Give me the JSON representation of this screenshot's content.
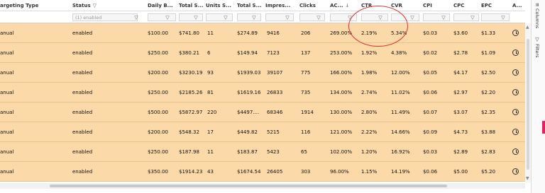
{
  "columns": [
    {
      "key": "targeting_type",
      "label": "argeting Type",
      "filter_icon": false
    },
    {
      "key": "status",
      "label": "Status",
      "filter_icon": true
    },
    {
      "key": "daily_budget",
      "label": "Daily B...",
      "filter_icon": false
    },
    {
      "key": "total_spend",
      "label": "Total S...",
      "filter_icon": false
    },
    {
      "key": "units_sold",
      "label": "Units S...",
      "filter_icon": false
    },
    {
      "key": "total_sales",
      "label": "Total S...",
      "filter_icon": false
    },
    {
      "key": "impressions",
      "label": "Impres...",
      "filter_icon": false
    },
    {
      "key": "clicks",
      "label": "Clicks",
      "filter_icon": false
    },
    {
      "key": "acos",
      "label": "AC...",
      "filter_icon": false,
      "sort_icon": "↓"
    },
    {
      "key": "ctr",
      "label": "CTR",
      "filter_icon": false
    },
    {
      "key": "cvr",
      "label": "CVR",
      "filter_icon": false
    },
    {
      "key": "cpi",
      "label": "CPI",
      "filter_icon": false
    },
    {
      "key": "cpc",
      "label": "CPC",
      "filter_icon": false
    },
    {
      "key": "epc",
      "label": "EPC",
      "filter_icon": false
    },
    {
      "key": "actions",
      "label": "A...",
      "filter_icon": false
    }
  ],
  "filters": {
    "status_value": "(1) enabled",
    "funnel_glyph": "▽"
  },
  "rows": [
    {
      "targeting_type": "anual",
      "status": "enabled",
      "daily_budget": "$100.00",
      "total_spend": "$741.80",
      "units_sold": "11",
      "total_sales": "$274.89",
      "impressions": "9416",
      "clicks": "206",
      "acos": "269.00%",
      "ctr": "2.19%",
      "cvr": "5.34%",
      "cpi": "$0.03",
      "cpc": "$3.60",
      "epc": "$1.33"
    },
    {
      "targeting_type": "anual",
      "status": "enabled",
      "daily_budget": "$250.00",
      "total_spend": "$380.21",
      "units_sold": "6",
      "total_sales": "$149.94",
      "impressions": "7123",
      "clicks": "137",
      "acos": "253.00%",
      "ctr": "1.92%",
      "cvr": "4.38%",
      "cpi": "$0.02",
      "cpc": "$2.78",
      "epc": "$1.09"
    },
    {
      "targeting_type": "anual",
      "status": "enabled",
      "daily_budget": "$200.00",
      "total_spend": "$3230.19",
      "units_sold": "93",
      "total_sales": "$1939.03",
      "impressions": "39107",
      "clicks": "775",
      "acos": "166.00%",
      "ctr": "1.98%",
      "cvr": "12.00%",
      "cpi": "$0.05",
      "cpc": "$4.17",
      "epc": "$2.50"
    },
    {
      "targeting_type": "anual",
      "status": "enabled",
      "daily_budget": "$250.00",
      "total_spend": "$2185.26",
      "units_sold": "81",
      "total_sales": "$1619.16",
      "impressions": "26833",
      "clicks": "735",
      "acos": "134.00%",
      "ctr": "2.74%",
      "cvr": "11.02%",
      "cpi": "$0.06",
      "cpc": "$2.97",
      "epc": "$2.20"
    },
    {
      "targeting_type": "anual",
      "status": "enabled",
      "daily_budget": "$500.00",
      "total_spend": "$5872.97",
      "units_sold": "220",
      "total_sales": "$4497....",
      "impressions": "68346",
      "clicks": "1914",
      "acos": "130.00%",
      "ctr": "2.80%",
      "cvr": "11.49%",
      "cpi": "$0.07",
      "cpc": "$3.07",
      "epc": "$2.35"
    },
    {
      "targeting_type": "anual",
      "status": "enabled",
      "daily_budget": "$200.00",
      "total_spend": "$548.32",
      "units_sold": "17",
      "total_sales": "$449.82",
      "impressions": "5215",
      "clicks": "116",
      "acos": "121.00%",
      "ctr": "2.22%",
      "cvr": "14.66%",
      "cpi": "$0.09",
      "cpc": "$4.73",
      "epc": "$3.88"
    },
    {
      "targeting_type": "anual",
      "status": "enabled",
      "daily_budget": "$250.00",
      "total_spend": "$187.98",
      "units_sold": "11",
      "total_sales": "$183.87",
      "impressions": "5423",
      "clicks": "65",
      "acos": "102.00%",
      "ctr": "1.20%",
      "cvr": "16.92%",
      "cpi": "$0.03",
      "cpc": "$2.89",
      "epc": "$2.83"
    },
    {
      "targeting_type": "anual",
      "status": "enabled",
      "daily_budget": "$350.00",
      "total_spend": "$1914.23",
      "units_sold": "43",
      "total_sales": "$1674.54",
      "impressions": "26405",
      "clicks": "303",
      "acos": "96.00%",
      "ctr": "1.15%",
      "cvr": "14.19%",
      "cpi": "$0.06",
      "cpc": "$5.00",
      "epc": "$5.20"
    }
  ],
  "side_panel": {
    "columns_label": "Columns",
    "filters_label": "Filters",
    "columns_icon": "≡",
    "filters_icon": "▽"
  },
  "colors": {
    "row_highlight": "#fcd9a8",
    "annotation_circle": "#e03030",
    "side_marker": "#e0245e"
  }
}
